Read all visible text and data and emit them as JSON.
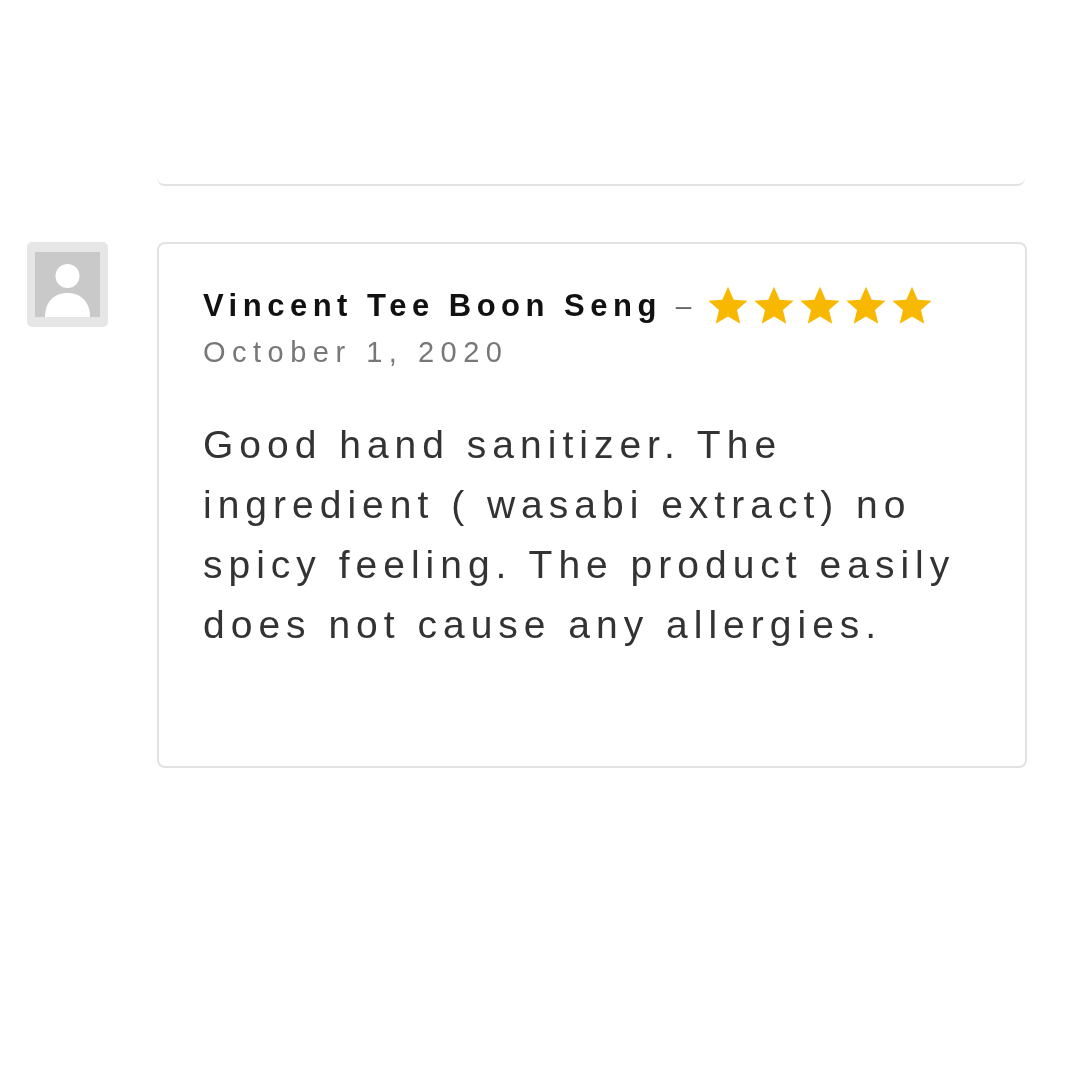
{
  "review": {
    "author": "Vincent Tee Boon Seng",
    "separator": "–",
    "stars": 5,
    "date": "October 1, 2020",
    "text": "Good hand sanitizer. The ingredient ( wasabi extract) no spicy feeling. The product easily does not cause any allergies."
  }
}
